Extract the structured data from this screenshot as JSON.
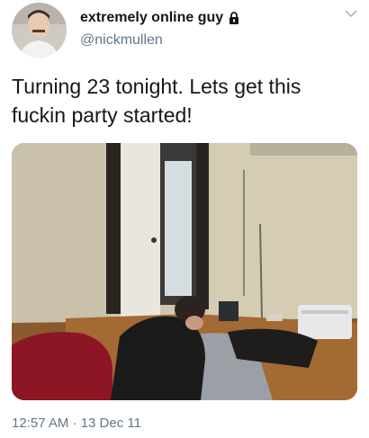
{
  "author": {
    "display_name": "extremely online guy",
    "handle": "@nickmullen",
    "protected": true,
    "avatar_icon": "profile-photo"
  },
  "tweet": {
    "text": "Turning 23 tonight. Lets get this fuckin party started!",
    "media": {
      "type": "photo",
      "description_icon": "photo"
    }
  },
  "meta": {
    "timestamp": "12:57 AM · 13 Dec 11"
  },
  "icons": {
    "lock": "lock-icon",
    "more": "chevron-down-icon"
  },
  "colors": {
    "text_primary": "#14171a",
    "text_secondary": "#657786"
  }
}
